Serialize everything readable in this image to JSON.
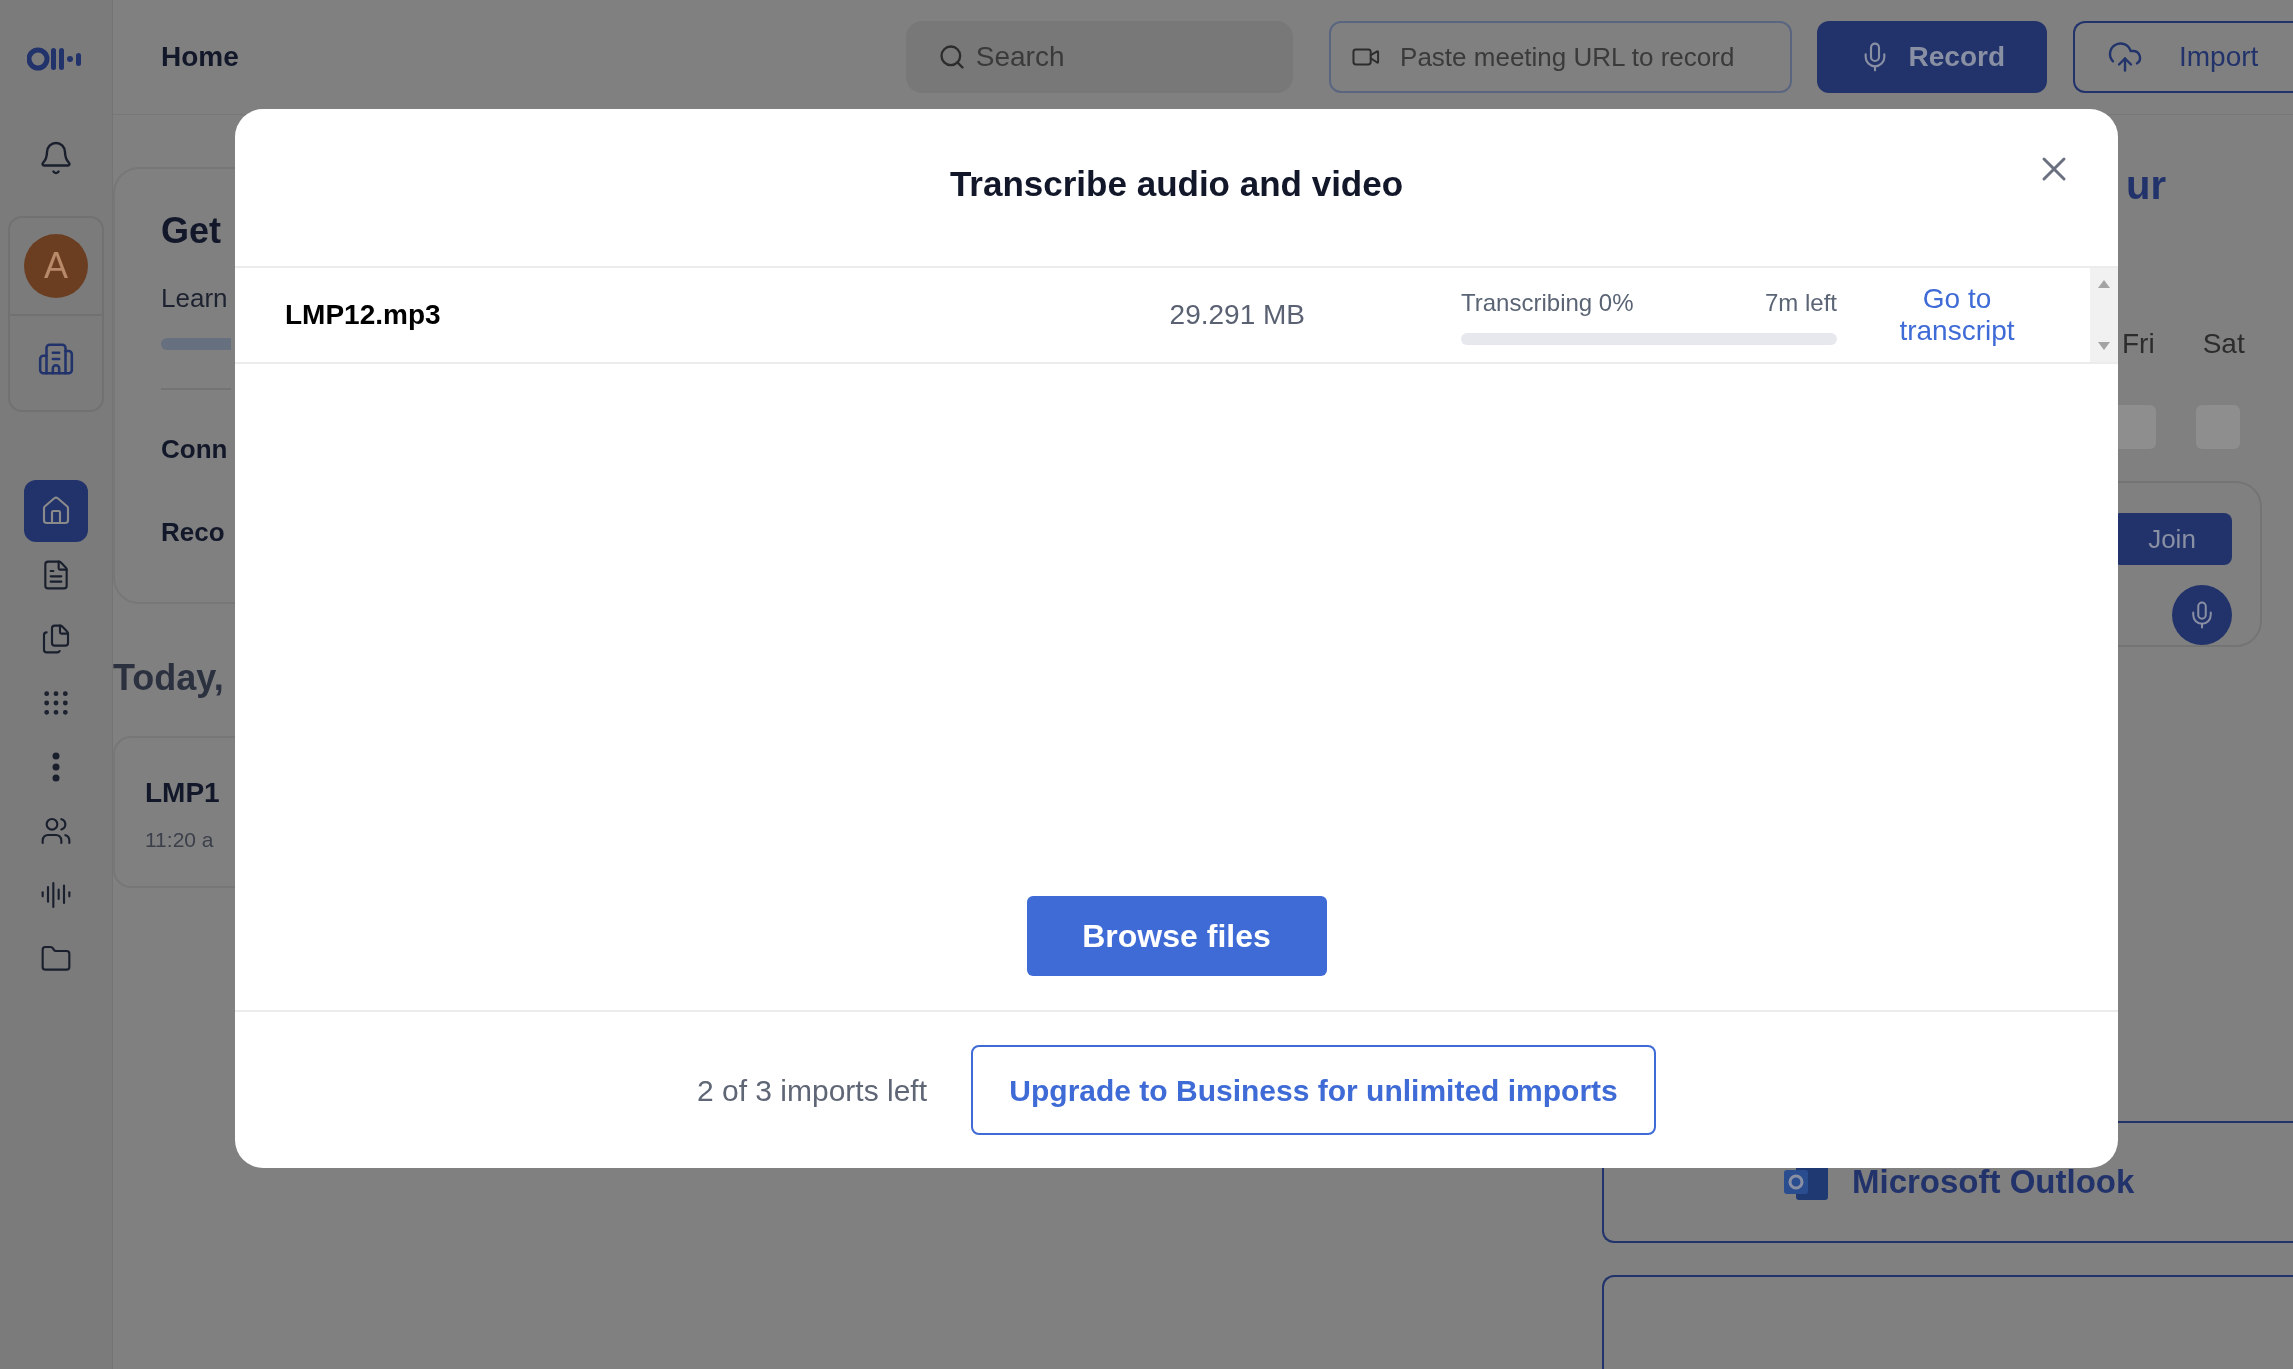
{
  "sidebar": {
    "avatar": "A",
    "items": [
      {
        "kind": "home",
        "selected": true
      },
      {
        "kind": "notes",
        "selected": false
      },
      {
        "kind": "stack",
        "selected": false
      },
      {
        "kind": "apps",
        "selected": false
      },
      {
        "kind": "more",
        "selected": false
      },
      {
        "kind": "people",
        "selected": false
      },
      {
        "kind": "voice",
        "selected": false
      },
      {
        "kind": "folder",
        "selected": false
      }
    ]
  },
  "header": {
    "title": "Home",
    "search": {
      "placeholder": "Search"
    },
    "meeting_url": {
      "placeholder": "Paste meeting URL to record"
    },
    "record": "Record",
    "import": "Import"
  },
  "background": {
    "left_card": {
      "title": "Get",
      "subtitle": "Learn",
      "links": [
        "Conn",
        "Reco"
      ]
    },
    "section_title": "Today,",
    "recording": {
      "title": "LMP1",
      "time": "11:20 a"
    },
    "calendar": {
      "title": "ur",
      "days": [
        "Fri",
        "Sat"
      ],
      "join": "Join"
    },
    "integrations": [
      "Microsoft Outlook"
    ]
  },
  "dialog": {
    "title": "Transcribe audio and video",
    "files": [
      {
        "name": "LMP12.mp3",
        "size": "29.291 MB",
        "status": "Transcribing 0%",
        "remaining": "7m left",
        "level": 0,
        "link": "Go to transcript"
      }
    ],
    "browse": "Browse files",
    "imports_left": "2 of 3 imports left",
    "upgrade": "Upgrade to Business for unlimited imports"
  }
}
